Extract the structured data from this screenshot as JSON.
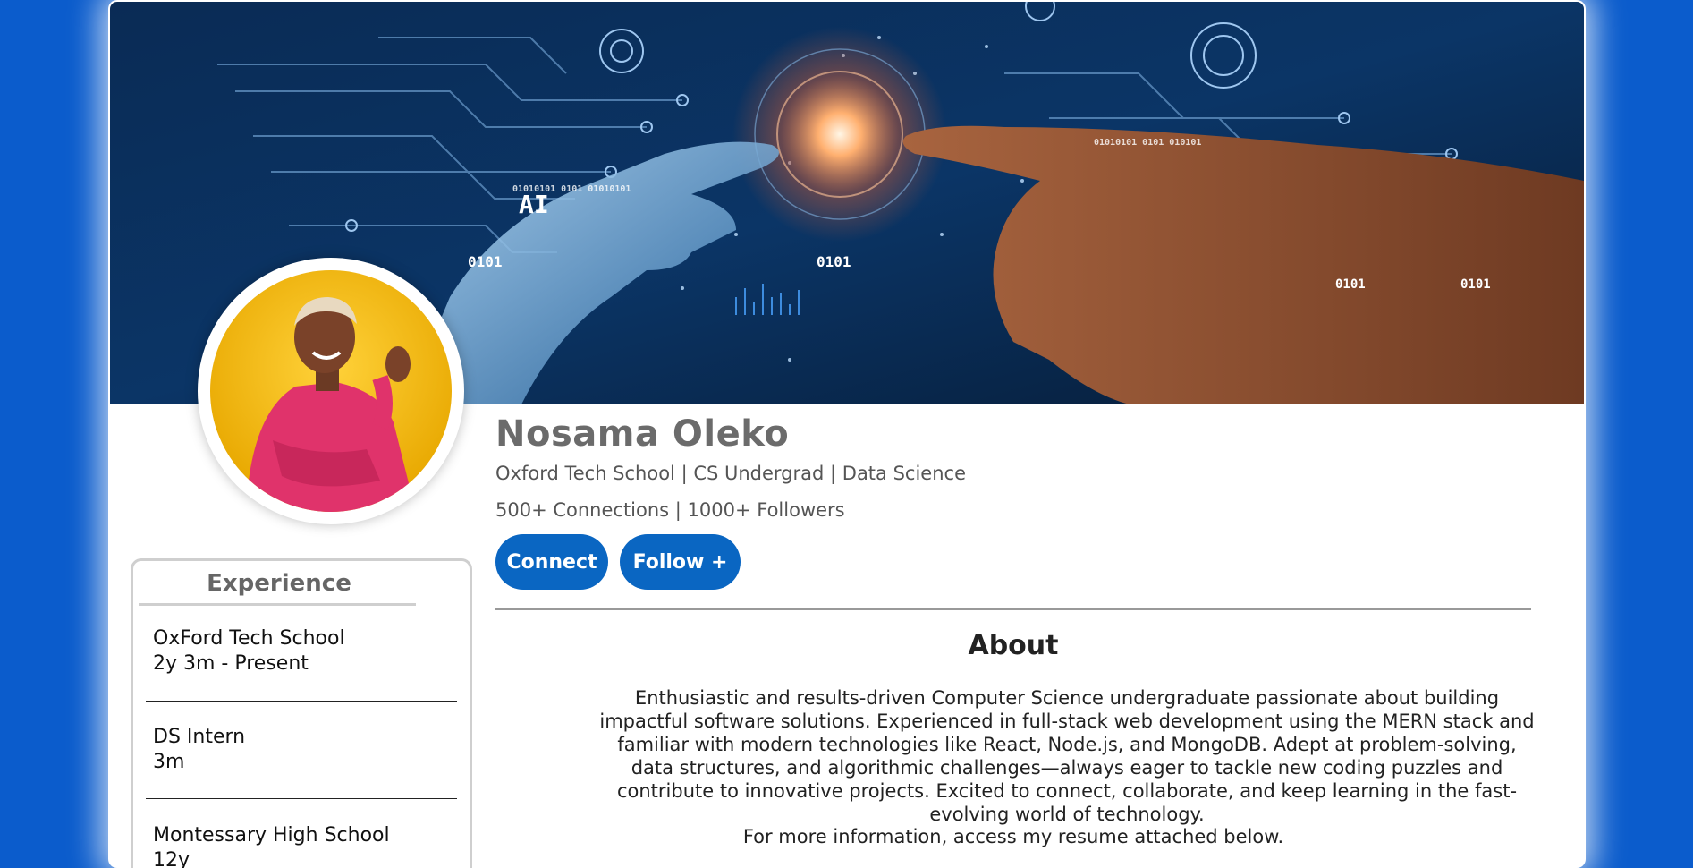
{
  "profile": {
    "name": "Nosama Oleko",
    "headline": "Oxford Tech School | CS Undergrad | Data Science",
    "stats": "500+ Connections | 1000+ Followers"
  },
  "banner": {
    "texts": [
      "AI",
      "0101",
      "01010101 0101 01010101",
      "0101",
      "01010101 0101 010101",
      "0101",
      "0101"
    ]
  },
  "actions": {
    "connect_label": "Connect",
    "follow_label": "Follow +"
  },
  "about": {
    "title": "About",
    "body": "Enthusiastic and results-driven Computer Science undergraduate passionate about building impactful software solutions. Experienced in full-stack web development using the MERN stack and familiar with modern technologies like React, Node.js, and MongoDB. Adept at problem-solving, data structures, and algorithmic challenges—always eager to tackle new coding puzzles and contribute to innovative projects. Excited to connect, collaborate, and keep learning in the fast-evolving world of technology.",
    "extra": "For more information, access my resume attached below."
  },
  "experience": {
    "title": "Experience",
    "items": [
      {
        "org": "OxFord Tech School",
        "duration": "2y 3m - Present"
      },
      {
        "org": "DS Intern",
        "duration": "3m"
      },
      {
        "org": "Montessary High School",
        "duration": "12y"
      }
    ]
  },
  "colors": {
    "page_background": "#0b5ccc",
    "button": "#0a66c2",
    "name_text": "#6b6b6b",
    "banner_dark": "#07203f"
  }
}
